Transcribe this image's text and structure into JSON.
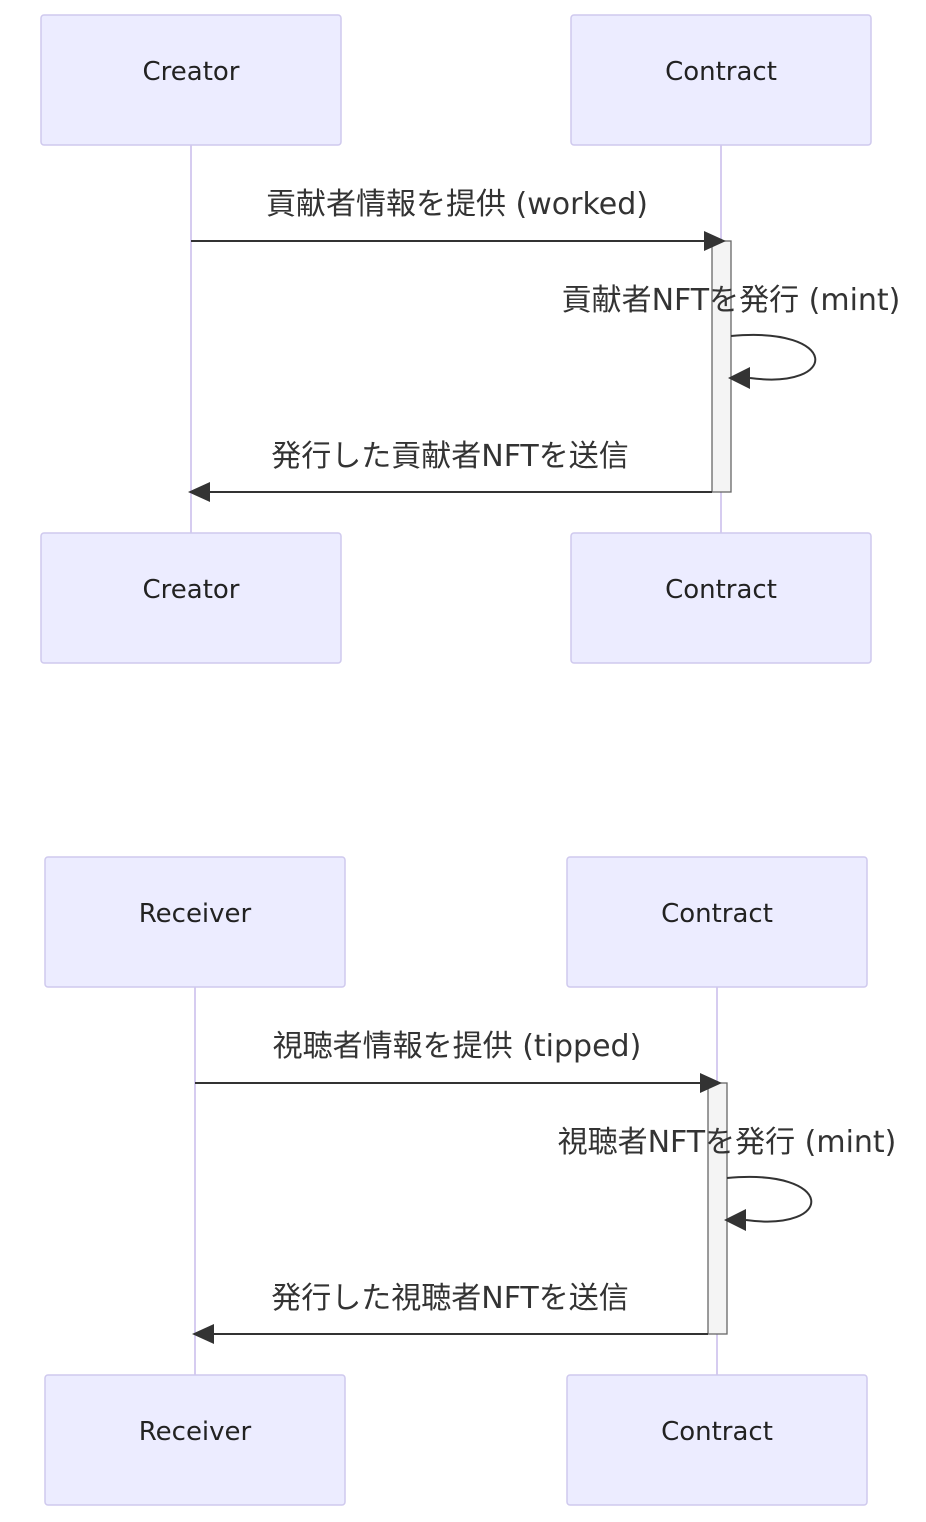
{
  "diagrams": [
    {
      "participants": [
        "Creator",
        "Contract"
      ],
      "messages": [
        {
          "from": "Creator",
          "to": "Contract",
          "label": "貢献者情報を提供 (worked)"
        },
        {
          "from": "Contract",
          "to": "Contract",
          "label": "貢献者NFTを発行 (mint)"
        },
        {
          "from": "Contract",
          "to": "Creator",
          "label": "発行した貢献者NFTを送信"
        }
      ]
    },
    {
      "participants": [
        "Receiver",
        "Contract"
      ],
      "messages": [
        {
          "from": "Receiver",
          "to": "Contract",
          "label": "視聴者情報を提供 (tipped)"
        },
        {
          "from": "Contract",
          "to": "Contract",
          "label": "視聴者NFTを発行 (mint)"
        },
        {
          "from": "Contract",
          "to": "Receiver",
          "label": "発行した視聴者NFTを送信"
        }
      ]
    }
  ],
  "colors": {
    "participant_fill": "#ECECFF",
    "participant_border": "#CFC9EE",
    "lifeline": "#D6CCF0",
    "arrow": "#333333",
    "activation_fill": "#F4F4F4"
  }
}
